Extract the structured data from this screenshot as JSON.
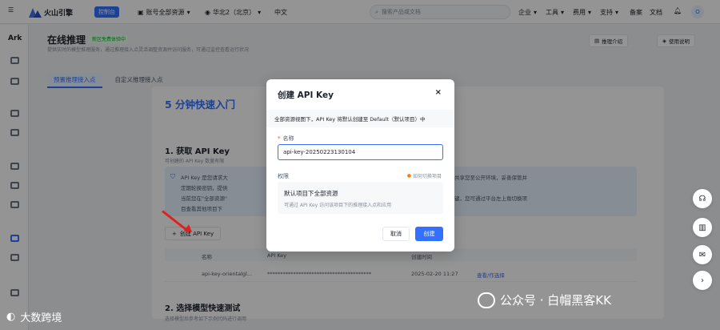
{
  "topbar": {
    "brand": "火山引擎",
    "console_badge": "控制台",
    "account": "账号全部资源",
    "region": "华北2（北京）",
    "language": "中文",
    "search_placeholder": "搜索产品或文档",
    "nav": [
      "企业",
      "工具",
      "费用",
      "支持",
      "备案",
      "文档"
    ],
    "avatar": "O"
  },
  "sidebar": {
    "app": "Ark"
  },
  "header": {
    "title": "在线推理",
    "tag": "新区免费体验中",
    "subtitle": "提供实时的模型推理服务，通过推理接入点灵活调整资源并访问服务，可通过监控查看运行状况",
    "intro_button": "推理介绍",
    "guide_button": "使用说明"
  },
  "tabs": [
    "预置推理接入点",
    "自定义推理接入点"
  ],
  "content": {
    "quickstart_title": "5 分钟快速入门",
    "step1_title": "1. 获取 API Key",
    "step1_sub": "可创建的 API Key 数量有限",
    "info_left": [
      "API Key 是您请求大",
      "定期轮换密钥，提供",
      "当前您在\"全部资源\"",
      "目查看其他项目下"
    ],
    "info_right": [
      "共享您至公开环境，妥善保管并",
      "键，您可通过平台左上角切换项"
    ],
    "create_button": "创建 API Key",
    "table_headers": [
      "名称",
      "API Key",
      "创建时间"
    ],
    "table_row": {
      "name": "api-key-orientalgl...",
      "key": "****************************************",
      "time": "2025-02-20 11:27",
      "action": "查看/作选择"
    },
    "step2_title": "2. 选择模型快速测试",
    "step2_sub": "选择模型后参考如下示例代码进行调用"
  },
  "modal": {
    "title": "创建 API Key",
    "close": "×",
    "notice": "全部资源视图下，API Key 将默认创建至 Default（默认项目）中",
    "name_label": "名称",
    "name_value": "api-key-20250223130104",
    "perm_label": "权限",
    "switch_link": "如何切换项目",
    "perm_title": "默认项目下全部资源",
    "perm_desc": "可通过 API Key 访问该项目下的推理接入点和应用",
    "cancel": "取消",
    "ok": "创建"
  },
  "watermarks": {
    "left": "大数跨境",
    "right": "公众号 · 白帽黑客KK"
  },
  "colors": {
    "primary": "#3370ff",
    "arrow": "#e02020",
    "success": "#00b42a"
  }
}
